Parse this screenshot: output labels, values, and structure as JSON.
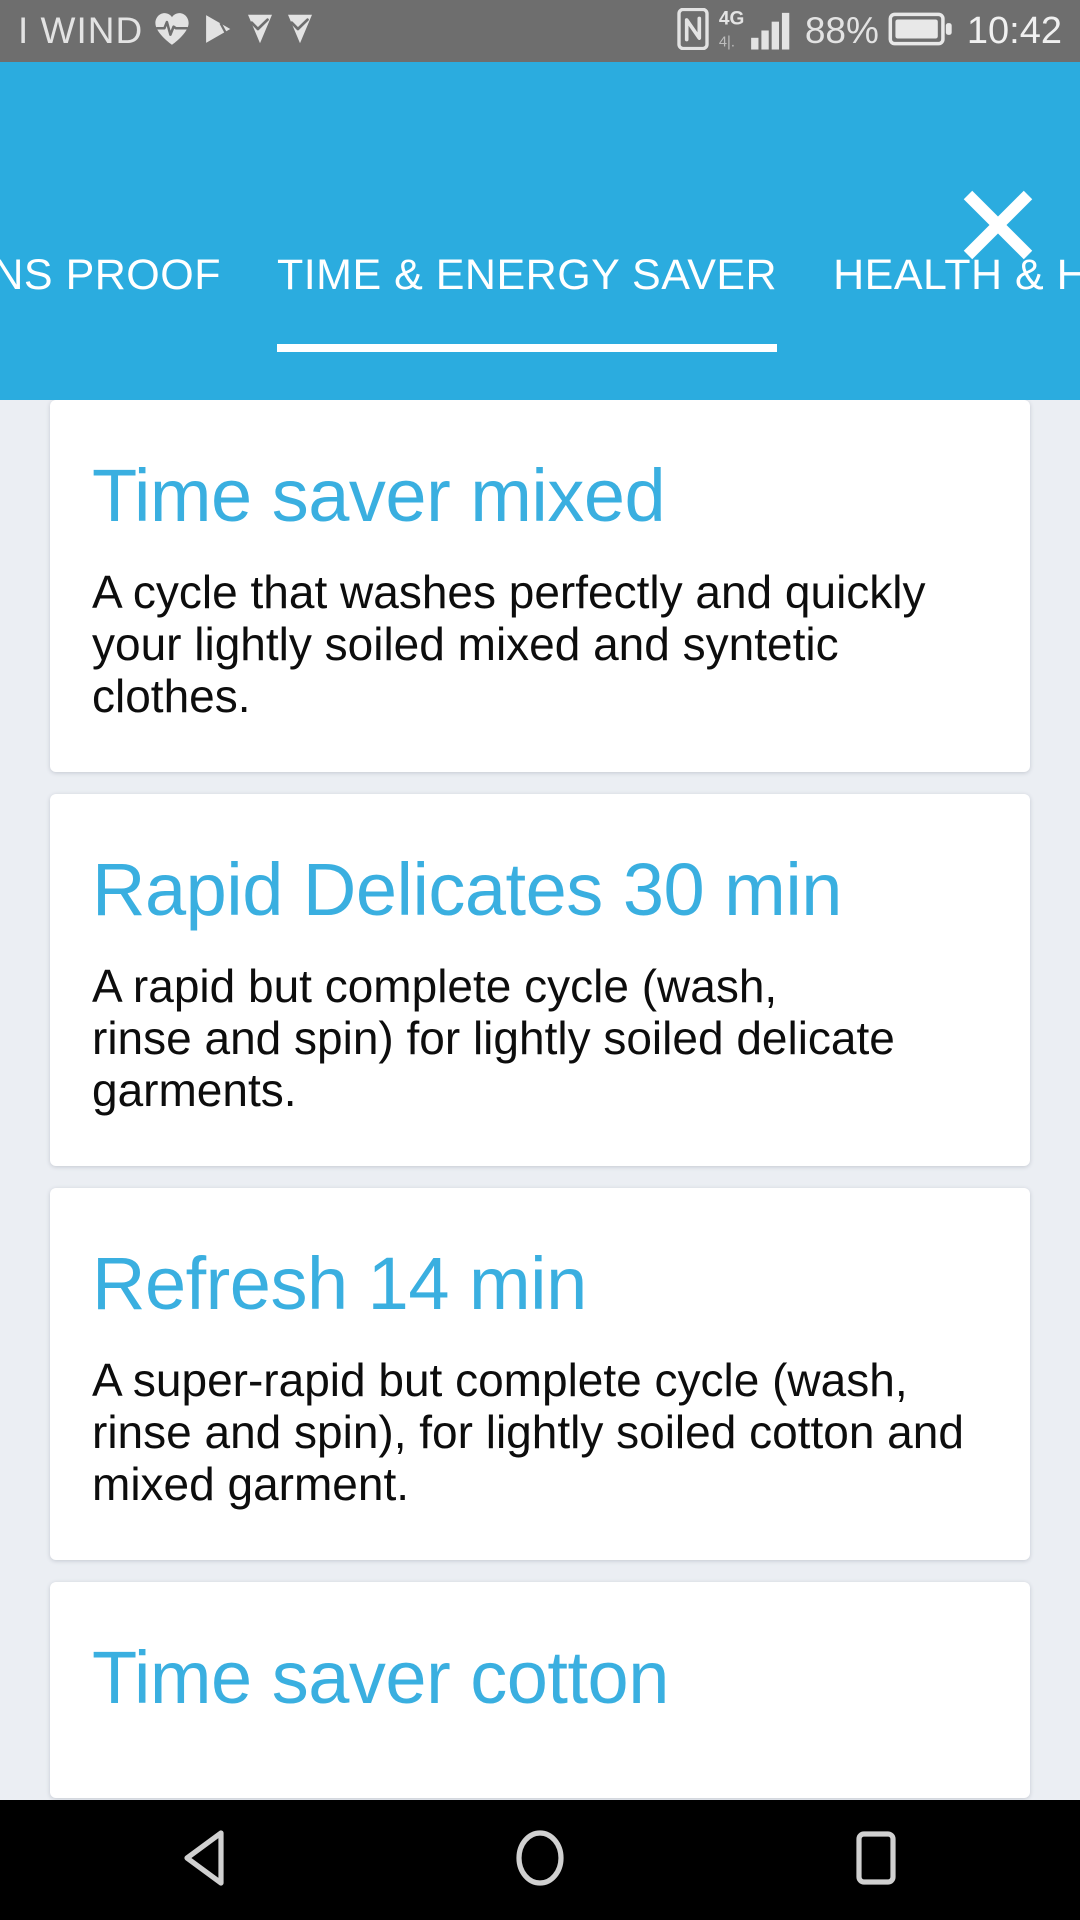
{
  "status_bar": {
    "carrier": "I WIND",
    "left_icons": [
      "heart-rate-icon",
      "play-store-icon",
      "download-icon",
      "download-icon"
    ],
    "network_type": "4G",
    "battery_percent": "88%",
    "clock": "10:42",
    "right_icons": [
      "nfc-icon",
      "signal-bars-icon",
      "battery-icon"
    ],
    "background_color": "#6e6e6e"
  },
  "header": {
    "background_color": "#2bacdf",
    "close_icon": "close-icon",
    "tabs": [
      {
        "label": "STAINS PROOF",
        "active": false
      },
      {
        "label": "TIME & ENERGY SAVER",
        "active": true
      },
      {
        "label": "HEALTH & HYGIENE",
        "active": false
      }
    ]
  },
  "content": {
    "accent_color": "#3aafe0",
    "background_color": "#ebeef3",
    "cards": [
      {
        "title": "Time saver mixed",
        "lines": [
          "A cycle that washes perfectly and quickly",
          "your lightly soiled mixed and syntetic",
          "clothes."
        ]
      },
      {
        "title": "Rapid Delicates 30 min",
        "lines": [
          "A rapid but complete cycle (wash,",
          "rinse and spin) for lightly soiled delicate",
          "garments."
        ]
      },
      {
        "title": "Refresh 14 min",
        "lines": [
          "A super-rapid but complete cycle (wash,",
          "rinse and spin), for lightly soiled cotton and",
          "mixed garment."
        ]
      },
      {
        "title": "Time saver cotton",
        "lines": []
      }
    ]
  },
  "nav_bar": {
    "background_color": "#000000",
    "buttons": [
      "back-button",
      "home-button",
      "recents-button"
    ]
  }
}
